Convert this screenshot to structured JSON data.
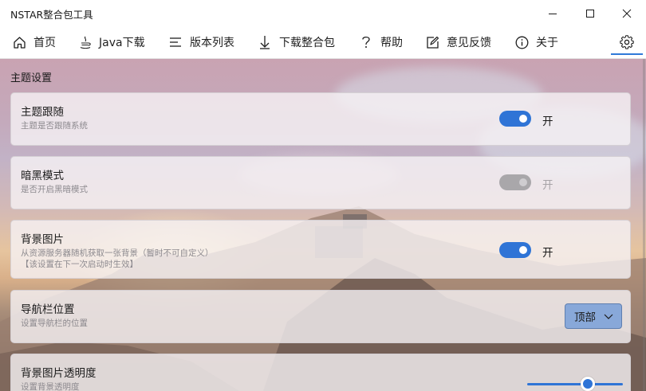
{
  "window": {
    "title": "NSTAR整合包工具"
  },
  "nav": {
    "items": [
      {
        "label": "首页",
        "icon": "home-icon"
      },
      {
        "label": "Java下载",
        "icon": "java-icon"
      },
      {
        "label": "版本列表",
        "icon": "list-icon"
      },
      {
        "label": "下载整合包",
        "icon": "download-icon"
      },
      {
        "label": "帮助",
        "icon": "help-icon"
      },
      {
        "label": "意见反馈",
        "icon": "feedback-icon"
      },
      {
        "label": "关于",
        "icon": "info-icon"
      }
    ],
    "active": "settings"
  },
  "page": {
    "section_title": "主题设置",
    "settings": [
      {
        "title": "主题跟随",
        "desc": "主题是否跟随系统",
        "state": "on",
        "state_label": "开"
      },
      {
        "title": "暗黑模式",
        "desc": "是否开启黑暗模式",
        "state": "disabled",
        "state_label": "开"
      },
      {
        "title": "背景图片",
        "desc": "从资源服务器随机获取一张背景（暂时不可自定义）",
        "desc2": "【该设置在下一次启动时生效】",
        "state": "on",
        "state_label": "开"
      },
      {
        "title": "导航栏位置",
        "desc": "设置导航栏的位置",
        "value": "顶部"
      },
      {
        "title": "背景图片透明度",
        "desc": "设置背景透明度",
        "slider_value": 0.63
      }
    ]
  },
  "colors": {
    "accent": "#2f74d6",
    "combo_bg": "#88a8d9"
  }
}
